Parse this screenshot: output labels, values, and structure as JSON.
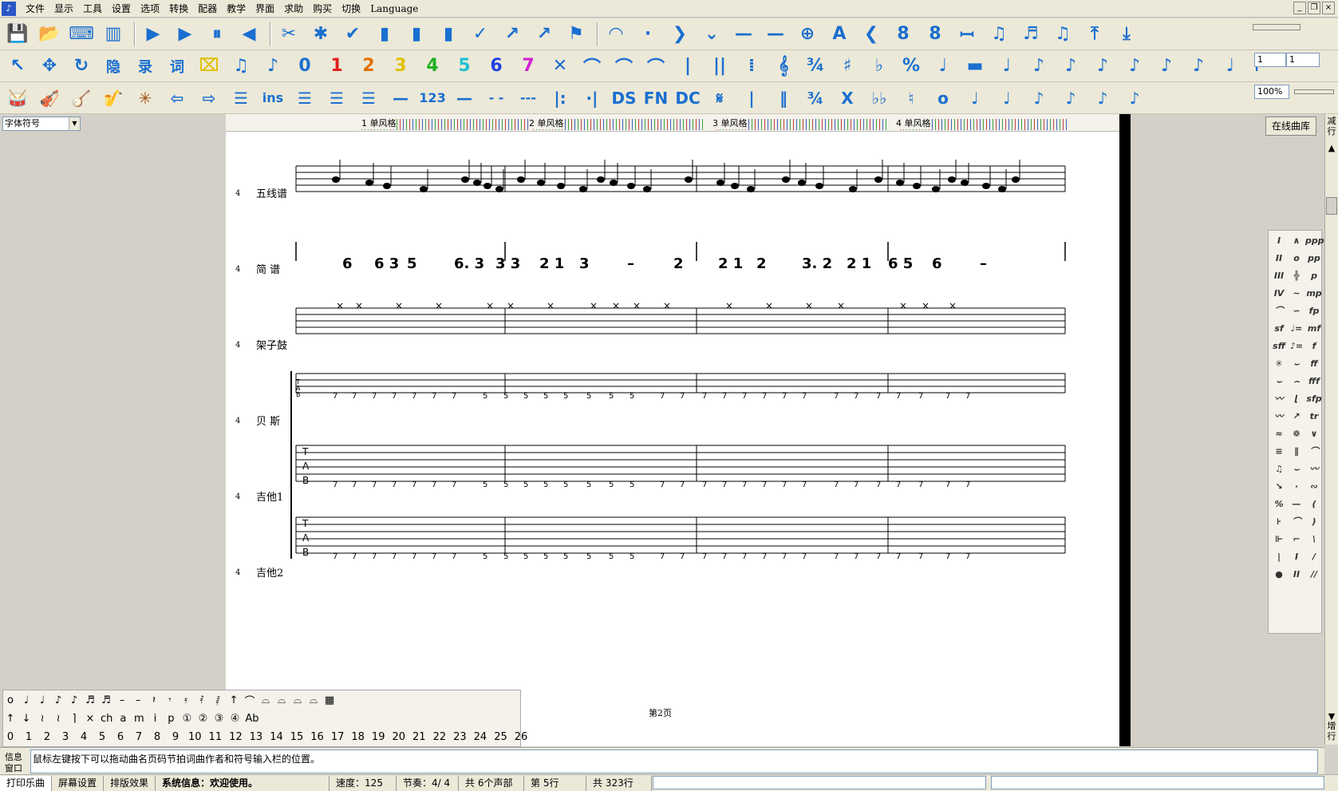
{
  "menubar": {
    "items": [
      "文件",
      "显示",
      "工具",
      "设置",
      "选项",
      "转换",
      "配器",
      "教学",
      "界面",
      "求助",
      "购买",
      "切换",
      "Language"
    ]
  },
  "toolbar1": {
    "icons": [
      "save-icon",
      "open-icon",
      "keyboard-icon",
      "piano-icon",
      "play-icon",
      "play-from-icon",
      "pause-icon",
      "rewind-icon",
      "cut-icon",
      "insert-icon",
      "check-icon",
      "auto-icon",
      "level-icon",
      "level2-icon",
      "spell-icon",
      "arrow-icon",
      "mark-icon",
      "flag-icon",
      "tie-icon",
      "dot-icon",
      "chevron-icon",
      "down-icon",
      "line-icon",
      "line2-icon",
      "target-icon",
      "text-a-icon",
      "back-icon",
      "8-plus-icon",
      "8-minus-icon",
      "repeat-icon",
      "notes-icon",
      "note-flag-icon",
      "note-beam-icon",
      "export-icon",
      "import-icon"
    ]
  },
  "toolbar2": {
    "labels": [
      "↖",
      "✥",
      "↻",
      "隐",
      "录",
      "词",
      "⌧",
      "♫",
      "♪",
      "0",
      "1",
      "2",
      "3",
      "4",
      "5",
      "6",
      "7",
      "✕",
      "⌒",
      "⌒",
      "⌒",
      "|",
      "||",
      "⁞",
      "𝄞",
      "¾",
      "♯",
      "♭",
      "%",
      "♩",
      "▬",
      "♩",
      "♪",
      "♪",
      "♪",
      "♪",
      "♪",
      "♪",
      "♩",
      "⊢"
    ],
    "field1": "1",
    "field2": "1"
  },
  "toolbar3": {
    "labels": [
      "🥁",
      "🎻",
      "🪕",
      "🎷",
      "✳",
      "⇦",
      "⇨",
      "☰",
      "ins",
      "☰",
      "☰",
      "☰",
      "—",
      "123",
      "—",
      "- -",
      "---",
      "|:",
      "·|",
      "DS",
      "FN",
      "DC",
      "𝄋",
      "|",
      "‖",
      "¾",
      "X",
      "♭♭",
      "♮",
      "o",
      "♩",
      "♩",
      "♪",
      "♪",
      "♪",
      "♪"
    ],
    "zoom": "100%"
  },
  "font_selector": "字体符号",
  "ruler": {
    "labels": [
      "1 单风格",
      "2 单风格",
      "3 单风格",
      "4 单风格"
    ]
  },
  "online_library": "在线曲库",
  "right_scroll": {
    "top": "减行",
    "bottom": "增行"
  },
  "tracks": [
    {
      "num": "4",
      "name": "五线谱"
    },
    {
      "num": "4",
      "name": "简 谱"
    },
    {
      "num": "4",
      "name": "架子鼓"
    },
    {
      "num": "4",
      "name": "贝 斯"
    },
    {
      "num": "4",
      "name": "吉他1"
    },
    {
      "num": "4",
      "name": "吉他2"
    }
  ],
  "jianpu_line": [
    "6",
    "6 3",
    "5",
    "6. 3",
    "3 3",
    "2 1",
    "3",
    "–",
    "2",
    "2 1",
    "2",
    "3. 2",
    "2 1",
    "6 5",
    "6",
    "–"
  ],
  "tab_letters": [
    "T",
    "A",
    "B"
  ],
  "page_number": "第2页",
  "symbol_palette": [
    "I",
    "∧",
    "ppp",
    "II",
    "o",
    "pp",
    "III",
    "╬",
    "p",
    "IV",
    "~",
    "mp",
    "⌒",
    "∽",
    "fp",
    "sf",
    "♩=",
    "mf",
    "sff",
    "♪=",
    "f",
    "✳",
    "⌣",
    "ff",
    "⌣",
    "⌢",
    "fff",
    "〰",
    "⌊",
    "sfp",
    "〰",
    "↗",
    "tr",
    "≈",
    "❁",
    "∨",
    "≡",
    "∥",
    "⌒",
    "♫",
    "⌣",
    "〰",
    "↘",
    "·",
    "∾",
    "%",
    "—",
    "(",
    "⊦",
    "⌒",
    ")",
    "⊩",
    "⌐",
    "\\",
    "|",
    "I",
    "/",
    "●",
    "II",
    "//"
  ],
  "note_palette": {
    "row1": [
      "o",
      "♩",
      "♩",
      "♪",
      "♪",
      "♬",
      "♬",
      "–",
      "–",
      "𝄽",
      "𝄾",
      "𝄿",
      "𝅀",
      "𝅁",
      "↑",
      "⌒",
      "⌓",
      "⌓",
      "⌓",
      "⌓",
      "▦"
    ],
    "row2": [
      "↑",
      "↓",
      "≀",
      "≀",
      "⌉",
      "×",
      "ch",
      "a",
      "m",
      "i",
      "p",
      "①",
      "②",
      "③",
      "④",
      "Ab"
    ],
    "row3": [
      "0",
      "1",
      "2",
      "3",
      "4",
      "5",
      "6",
      "7",
      "8",
      "9",
      "10",
      "11",
      "12",
      "13",
      "14",
      "15",
      "16",
      "17",
      "18",
      "19",
      "20",
      "21",
      "22",
      "23",
      "24",
      "25",
      "26"
    ]
  },
  "info": {
    "label1": "信息",
    "label2": "窗口",
    "text": "鼠标左键按下可以拖动曲名页码节拍词曲作者和符号输入栏的位置。"
  },
  "status": {
    "tabs": [
      "打印乐曲",
      "屏幕设置",
      "排版效果"
    ],
    "system": "系统信息：欢迎使用。",
    "speed": "速度：125",
    "beat": "节奏：4/ 4",
    "voices": "共 6个声部",
    "row": "第 5行",
    "total": "共 323行"
  }
}
